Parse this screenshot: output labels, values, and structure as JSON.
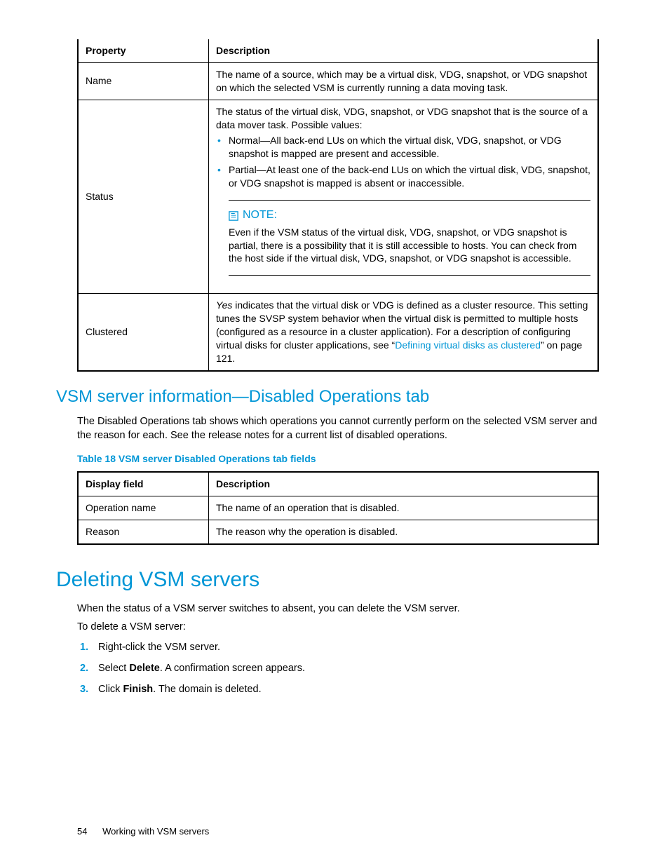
{
  "table1": {
    "headers": [
      "Property",
      "Description"
    ],
    "rows": {
      "name": {
        "prop": "Name",
        "desc": "The name of a source, which may be a virtual disk, VDG, snapshot, or VDG snapshot on which the selected VSM is currently running a data moving task."
      },
      "status": {
        "prop": "Status",
        "intro": "The status of the virtual disk, VDG, snapshot, or VDG snapshot that is the source of a data mover task. Possible values:",
        "b1": "Normal—All back-end LUs on which the virtual disk, VDG, snapshot, or VDG snapshot is mapped are present and accessible.",
        "b2": "Partial—At least one of the back-end LUs on which the virtual disk, VDG, snapshot, or VDG snapshot is mapped is absent or inaccessible.",
        "note_label": "NOTE:",
        "note_body": "Even if the VSM status of the virtual disk, VDG, snapshot, or VDG snapshot is partial, there is a possibility that it is still accessible to hosts. You can check from the host side if the virtual disk, VDG, snapshot, or VDG snapshot is accessible."
      },
      "clustered": {
        "prop": "Clustered",
        "yes": "Yes",
        "body": " indicates that the virtual disk or VDG is defined as a cluster resource. This setting tunes the SVSP system behavior when the virtual disk is permitted to multiple hosts (configured as a resource in a cluster application). For a description of configuring virtual disks for cluster applications, see “",
        "link": "Defining virtual disks as clustered",
        "tail": "” on page 121."
      }
    }
  },
  "h2a": "VSM server information—Disabled Operations tab",
  "p_h2a": "The Disabled Operations tab shows which operations you cannot currently perform on the selected VSM server and the reason for each. See the release notes for a current list of disabled operations.",
  "table2_title": "Table 18 VSM server Disabled Operations tab fields",
  "table2": {
    "headers": [
      "Display field",
      "Description"
    ],
    "r1": {
      "c1": "Operation name",
      "c2": "The name of an operation that is disabled."
    },
    "r2": {
      "c1": "Reason",
      "c2": "The reason why the operation is disabled."
    }
  },
  "h1": "Deleting VSM servers",
  "p_h1a": "When the status of a VSM server switches to absent, you can delete the VSM server.",
  "p_h1b": "To delete a VSM server:",
  "steps": {
    "s1": "Right-click the VSM server.",
    "s2a": "Select ",
    "s2b": "Delete",
    "s2c": ". A confirmation screen appears.",
    "s3a": "Click ",
    "s3b": "Finish",
    "s3c": ". The domain is deleted."
  },
  "footer": {
    "page": "54",
    "title": "Working with VSM servers"
  }
}
